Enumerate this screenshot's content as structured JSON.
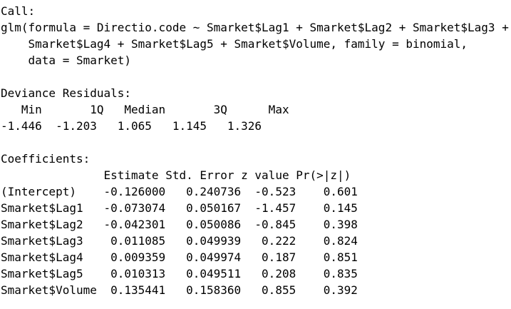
{
  "call": {
    "header": "Call:",
    "lines": [
      "glm(formula = Directio.code ~ Smarket$Lag1 + Smarket$Lag2 + Smarket$Lag3 +",
      "    Smarket$Lag4 + Smarket$Lag5 + Smarket$Volume, family = binomial,",
      "    data = Smarket)"
    ]
  },
  "deviance_residuals": {
    "header": "Deviance Residuals:",
    "labels_line": "   Min       1Q   Median       3Q      Max",
    "values_line": "-1.446  -1.203   1.065   1.145   1.326",
    "labels": [
      "Min",
      "1Q",
      "Median",
      "3Q",
      "Max"
    ],
    "values": [
      -1.446,
      -1.203,
      1.065,
      1.145,
      1.326
    ]
  },
  "coefficients": {
    "header": "Coefficients:",
    "header_line": "               Estimate Std. Error z value Pr(>|z|)",
    "rows_text": [
      "(Intercept)    -0.126000   0.240736  -0.523    0.601",
      "Smarket$Lag1   -0.073074   0.050167  -1.457    0.145",
      "Smarket$Lag2   -0.042301   0.050086  -0.845    0.398",
      "Smarket$Lag3    0.011085   0.049939   0.222    0.824",
      "Smarket$Lag4    0.009359   0.049974   0.187    0.851",
      "Smarket$Lag5    0.010313   0.049511   0.208    0.835",
      "Smarket$Volume  0.135441   0.158360   0.855    0.392"
    ],
    "columns": [
      "Estimate",
      "Std. Error",
      "z value",
      "Pr(>|z|)"
    ],
    "rows": [
      {
        "term": "(Intercept)",
        "estimate": -0.126,
        "std_error": 0.240736,
        "z_value": -0.523,
        "p_value": 0.601
      },
      {
        "term": "Smarket$Lag1",
        "estimate": -0.073074,
        "std_error": 0.050167,
        "z_value": -1.457,
        "p_value": 0.145
      },
      {
        "term": "Smarket$Lag2",
        "estimate": -0.042301,
        "std_error": 0.050086,
        "z_value": -0.845,
        "p_value": 0.398
      },
      {
        "term": "Smarket$Lag3",
        "estimate": 0.011085,
        "std_error": 0.049939,
        "z_value": 0.222,
        "p_value": 0.824
      },
      {
        "term": "Smarket$Lag4",
        "estimate": 0.009359,
        "std_error": 0.049974,
        "z_value": 0.187,
        "p_value": 0.851
      },
      {
        "term": "Smarket$Lag5",
        "estimate": 0.010313,
        "std_error": 0.049511,
        "z_value": 0.208,
        "p_value": 0.835
      },
      {
        "term": "Smarket$Volume",
        "estimate": 0.135441,
        "std_error": 0.15836,
        "z_value": 0.855,
        "p_value": 0.392
      }
    ]
  },
  "colors": {
    "text": "#000000",
    "background": "#ffffff"
  }
}
